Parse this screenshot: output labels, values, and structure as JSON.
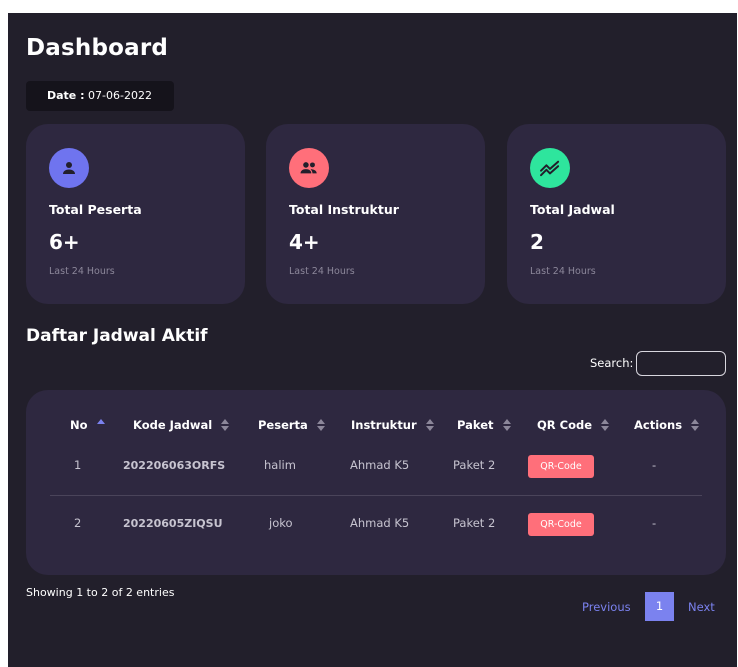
{
  "page": {
    "title": "Dashboard"
  },
  "date": {
    "label": "Date :",
    "value": "07-06-2022"
  },
  "cards": [
    {
      "icon": "user-icon",
      "color": "#6f74ef",
      "label": "Total Peserta",
      "value": "6+",
      "sub": "Last 24 Hours"
    },
    {
      "icon": "users-icon",
      "color": "#ff6f7a",
      "label": "Total Instruktur",
      "value": "4+",
      "sub": "Last 24 Hours"
    },
    {
      "icon": "trending-icon",
      "color": "#2ee59d",
      "label": "Total Jadwal",
      "value": "2",
      "sub": "Last 24 Hours"
    }
  ],
  "section": {
    "title": "Daftar Jadwal Aktif"
  },
  "search": {
    "label": "Search:",
    "value": ""
  },
  "table": {
    "headers": [
      "No",
      "Kode Jadwal",
      "Peserta",
      "Instruktur",
      "Paket",
      "QR Code",
      "Actions"
    ],
    "rows": [
      {
        "no": "1",
        "kode": "202206063ORFS",
        "peserta": "halim",
        "instruktur": "Ahmad K5",
        "paket": "Paket 2",
        "qr": "QR-Code",
        "actions": "-"
      },
      {
        "no": "2",
        "kode": "20220605ZIQSU",
        "peserta": "joko",
        "instruktur": "Ahmad K5",
        "paket": "Paket 2",
        "qr": "QR-Code",
        "actions": "-"
      }
    ]
  },
  "footer": {
    "info": "Showing 1 to 2 of 2 entries"
  },
  "pagination": {
    "previous": "Previous",
    "current": "1",
    "next": "Next"
  },
  "colors": {
    "background": "#221f2b",
    "card": "#2e2840",
    "accent": "#7b82ef",
    "qr_button": "#ff6f7a"
  }
}
